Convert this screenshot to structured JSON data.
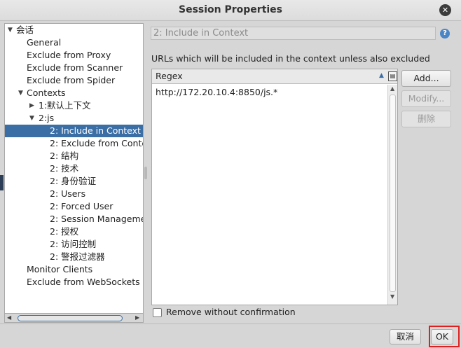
{
  "dialog": {
    "title": "Session Properties",
    "close_glyph": "✕"
  },
  "tree": {
    "items": [
      {
        "label": "会话",
        "level": 0,
        "expanded": true
      },
      {
        "label": "General",
        "level": 1
      },
      {
        "label": "Exclude from Proxy",
        "level": 1
      },
      {
        "label": "Exclude from Scanner",
        "level": 1
      },
      {
        "label": "Exclude from Spider",
        "level": 1
      },
      {
        "label": "Contexts",
        "level": 1,
        "expanded": true
      },
      {
        "label": "1:默认上下文",
        "level": 2,
        "expanded": false
      },
      {
        "label": "2:js",
        "level": 2,
        "expanded": true
      },
      {
        "label": "2: Include in Context",
        "level": 3,
        "selected": true
      },
      {
        "label": "2: Exclude from Conte",
        "level": 3
      },
      {
        "label": "2: 结构",
        "level": 3
      },
      {
        "label": "2: 技术",
        "level": 3
      },
      {
        "label": "2: 身份验证",
        "level": 3
      },
      {
        "label": "2: Users",
        "level": 3
      },
      {
        "label": "2: Forced User",
        "level": 3
      },
      {
        "label": "2: Session Manageme",
        "level": 3
      },
      {
        "label": "2: 授权",
        "level": 3
      },
      {
        "label": "2: 访问控制",
        "level": 3
      },
      {
        "label": "2: 警报过滤器",
        "level": 3
      },
      {
        "label": "Monitor Clients",
        "level": 1
      },
      {
        "label": "Exclude from WebSockets",
        "level": 1
      }
    ]
  },
  "panel": {
    "header": "2: Include in Context",
    "help_glyph": "?",
    "description": "URLs which will be included in the context unless also excluded",
    "table": {
      "column": "Regex",
      "sort_glyph": "▲",
      "column_select_glyph": "▤",
      "rows": [
        "http://172.20.10.4:8850/js.*"
      ]
    },
    "buttons": {
      "add": "Add...",
      "modify": "Modify...",
      "delete": "删除"
    },
    "checkbox": {
      "label": "Remove without confirmation",
      "checked": false
    }
  },
  "footer": {
    "cancel": "取消",
    "ok": "OK"
  },
  "colors": {
    "selection": "#3a6ea5",
    "highlight_box": "#e02020"
  }
}
